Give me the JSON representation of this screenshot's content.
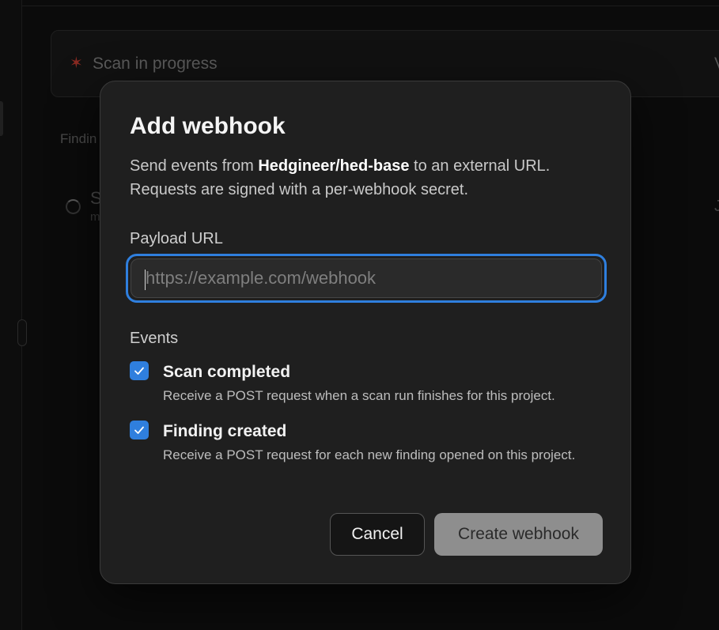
{
  "background": {
    "status_text": "Scan in progress",
    "right_header_fragment": "V",
    "section_fragment": "Findin",
    "row_title_fragment": "S",
    "row_sub_fragment": "m",
    "row_right_fragment": "J"
  },
  "modal": {
    "title": "Add webhook",
    "desc_prefix": "Send events from ",
    "repo": "Hedgineer/hed-base",
    "desc_suffix": " to an external URL.",
    "desc_line2": "Requests are signed with a per-webhook secret.",
    "payload_label": "Payload URL",
    "payload_value": "",
    "payload_placeholder": "https://example.com/webhook",
    "events_label": "Events",
    "events": [
      {
        "title": "Scan completed",
        "description": "Receive a POST request when a scan run finishes for this project.",
        "checked": true
      },
      {
        "title": "Finding created",
        "description": "Receive a POST request for each new finding opened on this project.",
        "checked": true
      }
    ],
    "cancel_label": "Cancel",
    "create_label": "Create webhook"
  },
  "colors": {
    "accent": "#2f7fde",
    "modal_bg": "#1f1f1f",
    "disabled_button": "#8e8e8e"
  },
  "icons": {
    "status": "asterisk-icon",
    "loading": "spinner-icon",
    "checkbox": "check-icon"
  }
}
